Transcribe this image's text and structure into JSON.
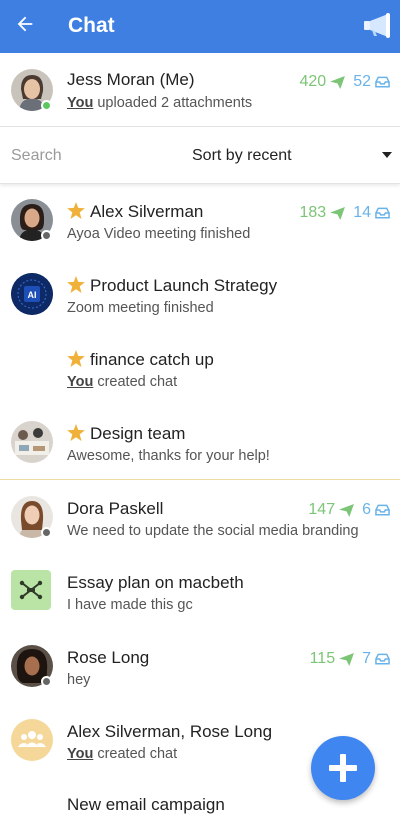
{
  "header": {
    "title": "Chat",
    "back_icon": "arrow-left-icon",
    "action_icon": "megaphone-icon"
  },
  "me": {
    "name": "Jess Moran (Me)",
    "you_label": "You",
    "subtitle": "uploaded 2 attachments",
    "sent_count": "420",
    "received_count": "52",
    "status": "online"
  },
  "search": {
    "placeholder": "Search",
    "sort_label": "Sort by recent"
  },
  "chats": [
    {
      "name": "Alex Silverman",
      "starred": true,
      "subtitle": "Ayoa Video meeting finished",
      "sent_count": "183",
      "received_count": "14",
      "status": "offline"
    },
    {
      "name": "Product Launch Strategy",
      "starred": true,
      "subtitle": "Zoom meeting finished",
      "avatar_text": "AI"
    },
    {
      "name": "finance catch up",
      "starred": true,
      "you_label": "You",
      "subtitle": "created chat"
    },
    {
      "name": "Design team",
      "starred": true,
      "subtitle": "Awesome, thanks for your help!"
    },
    {
      "name": "Dora Paskell",
      "subtitle": "We need to update the social media branding",
      "sent_count": "147",
      "received_count": "6",
      "status": "offline"
    },
    {
      "name": "Essay plan on macbeth",
      "subtitle": "I have made this gc"
    },
    {
      "name": "Rose Long",
      "subtitle": "hey",
      "sent_count": "115",
      "received_count": "7",
      "status": "offline"
    },
    {
      "name": "Alex Silverman, Rose Long",
      "you_label": "You",
      "subtitle": "created chat"
    },
    {
      "name": "New email campaign"
    }
  ],
  "colors": {
    "header": "#3f7fe2",
    "sent": "#7cc576",
    "received": "#6ab3e8",
    "star": "#f0b13a",
    "fab": "#3f86f0"
  }
}
